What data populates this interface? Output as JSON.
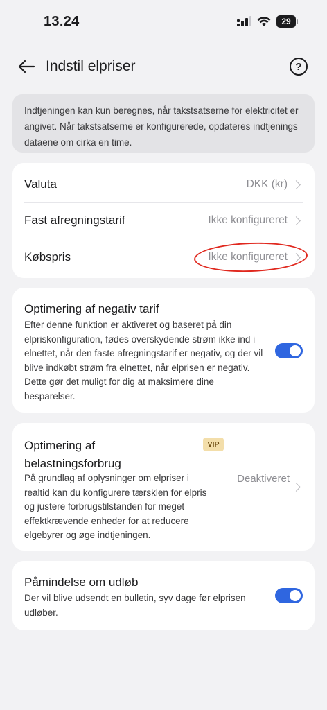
{
  "status_bar": {
    "time": "13.24",
    "battery": "29"
  },
  "header": {
    "title": "Indstil elpriser",
    "help": "?"
  },
  "info_text": "Indtjeningen kan kun beregnes, når takstsatserne for elektricitet er angivet. Når takstsatserne er konfigurerede, opdateres indtjeningsdataene om cirka en time.",
  "settings": [
    {
      "label": "Valuta",
      "value": "DKK (kr)"
    },
    {
      "label": "Fast afregningstarif",
      "value": "Ikke konfigureret"
    },
    {
      "label": "Købspris",
      "value": "Ikke konfigureret"
    }
  ],
  "negative_tariff": {
    "title": "Optimering af negativ tarif",
    "desc": "Efter denne funktion er aktiveret og baseret på din elpriskonfiguration, fødes overskydende strøm ikke ind i elnettet, når den faste afregningstarif er negativ, og der vil blive indkøbt strøm fra elnettet, når elprisen er negativ. Dette gør det muligt for dig at maksimere dine besparelser.",
    "enabled": true
  },
  "load_optimization": {
    "title": "Optimering af belastningsforbrug",
    "badge": "VIP",
    "desc": "På grundlag af oplysninger om elpriser i realtid kan du konfigurere tærsklen for elpris og justere forbrugstilstanden for meget effektkrævende enheder for at reducere elgebyrer og øge indtjeningen.",
    "status": "Deaktiveret"
  },
  "expiry_reminder": {
    "title": "Påmindelse om udløb",
    "desc": "Der vil blive udsendt en bulletin, syv dage før elprisen udløber.",
    "enabled": true
  },
  "colors": {
    "accent": "#2f66e0",
    "annotation": "#e0281e",
    "background": "#f2f2f4"
  }
}
